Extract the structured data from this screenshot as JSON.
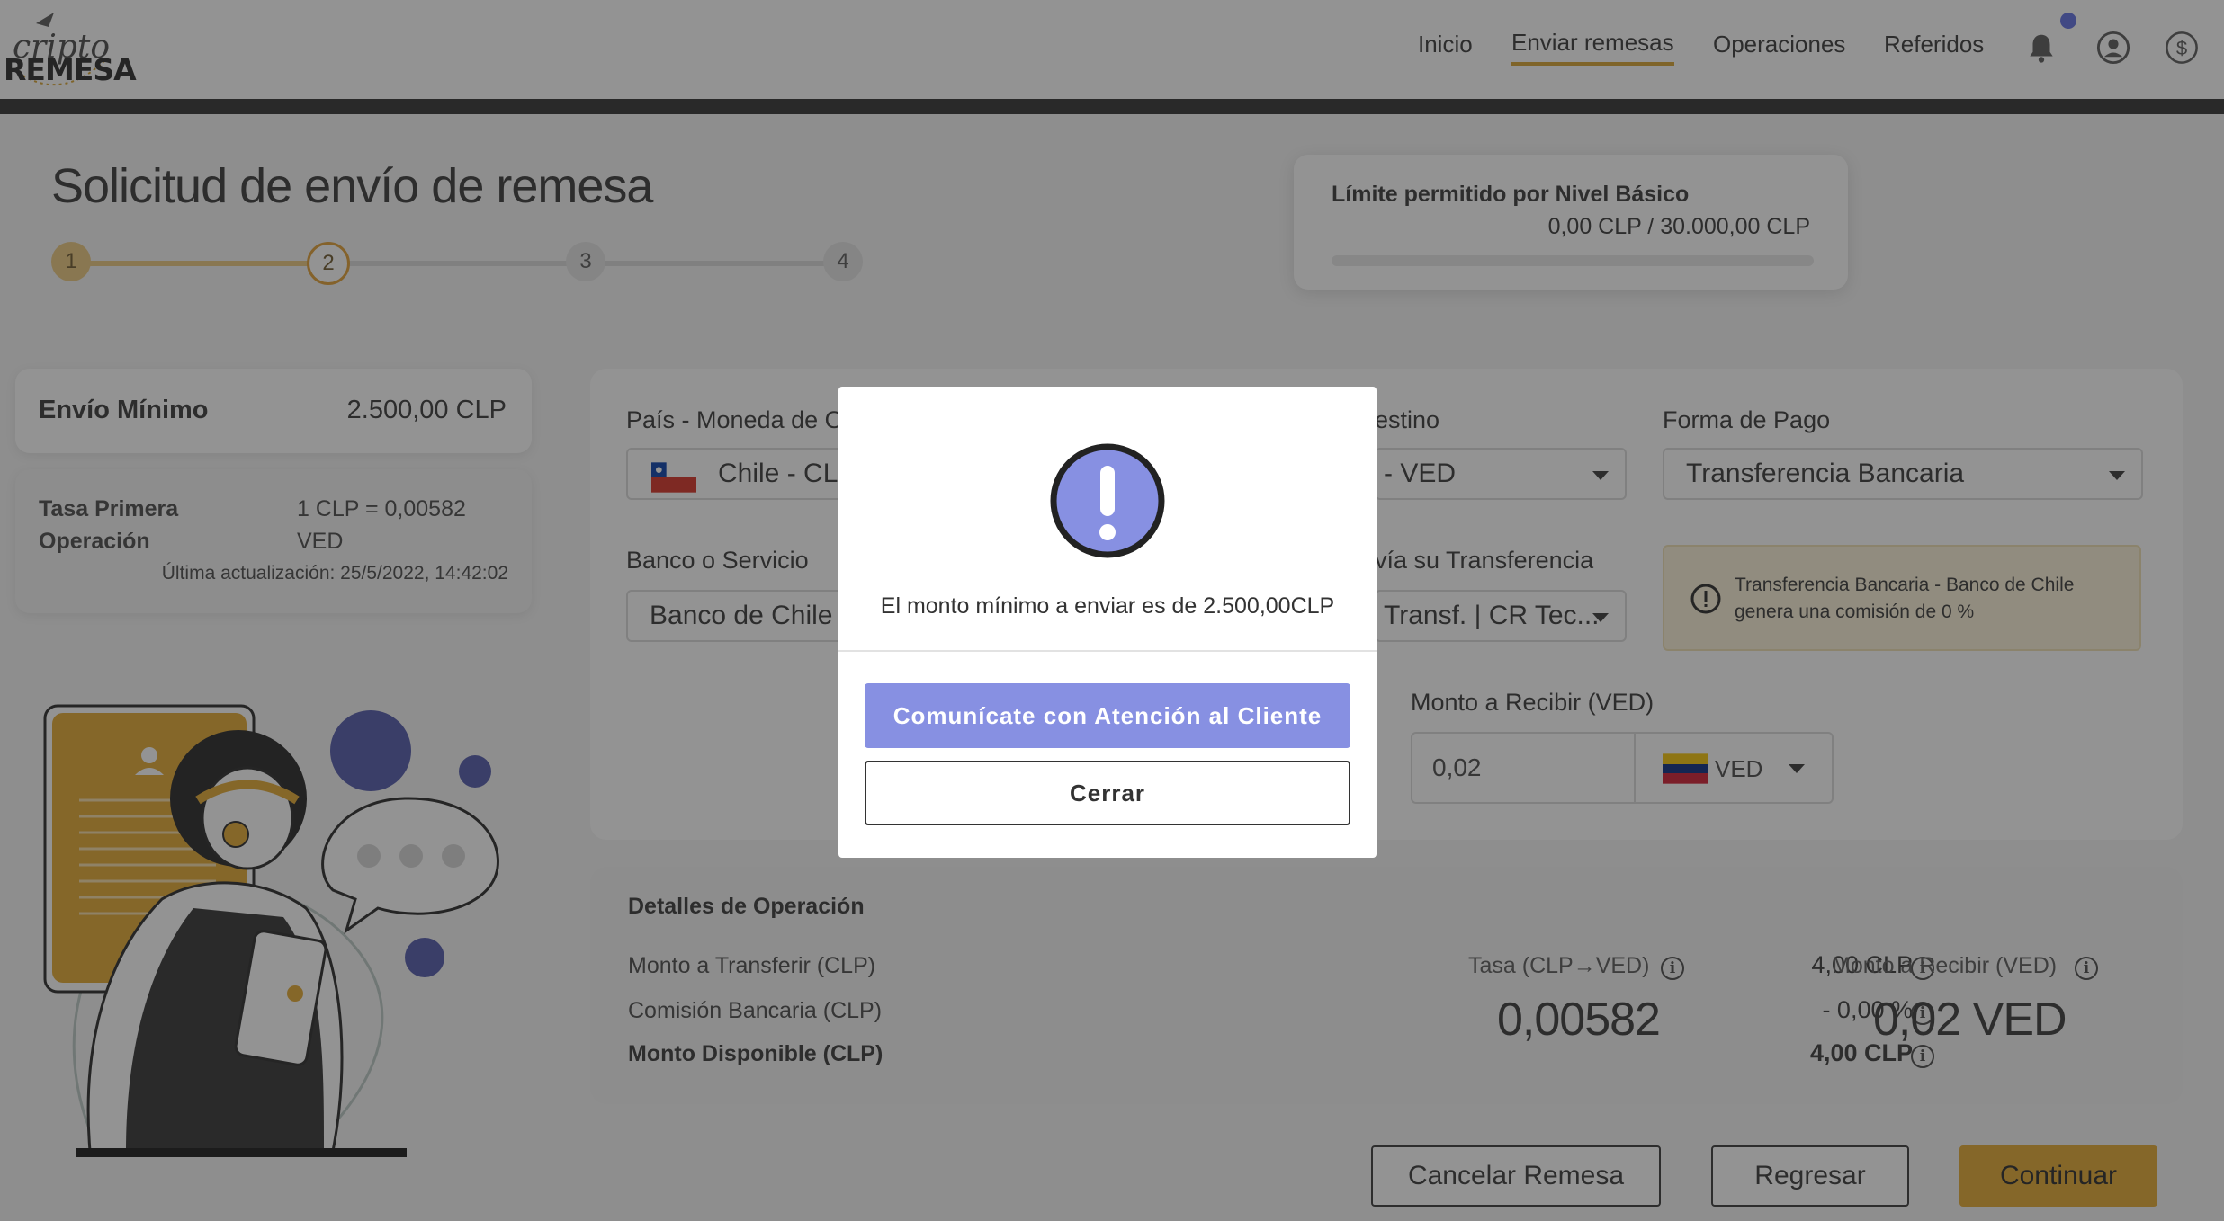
{
  "header": {
    "logo_top": "cripto",
    "logo_bottom": "REMESA",
    "nav": [
      "Inicio",
      "Enviar remesas",
      "Operaciones",
      "Referidos"
    ],
    "active_nav": "Enviar remesas",
    "icons": [
      "bell-icon",
      "user-icon",
      "dollar-icon"
    ]
  },
  "page": {
    "title": "Solicitud de envío de remesa",
    "steps": [
      "1",
      "2",
      "3",
      "4"
    ],
    "current_step": 2
  },
  "limit": {
    "title": "Límite permitido por Nivel Básico",
    "value": "0,00 CLP / 30.000,00 CLP",
    "progress_fraction": 0
  },
  "minimum": {
    "label": "Envío Mínimo",
    "value": "2.500,00 CLP"
  },
  "rate": {
    "label": "Tasa Primera Operación",
    "value": "1 CLP = 0,00582 VED",
    "updated": "Última actualización: 25/5/2022, 14:42:02"
  },
  "form": {
    "origin_label": "País - Moneda de O",
    "origin_value": "Chile - CL",
    "dest_label": "estino",
    "dest_value": "- VED",
    "payment_label": "Forma de Pago",
    "payment_value": "Transferencia Bancaria",
    "bank_label": "Banco o Servicio",
    "bank_value": "Banco de Chile",
    "via_label": "vía su Transferencia",
    "via_value": "Transf. | CR Tec...",
    "notice": "Transferencia Bancaria - Banco de Chile genera una comisión de 0 %",
    "receive_label": "Monto a Recibir (VED)",
    "receive_value": "0,02",
    "receive_currency": "VED"
  },
  "details": {
    "title": "Detalles de Operación",
    "rows": [
      {
        "label": "Monto a Transferir (CLP)",
        "value": "4,00 CLP"
      },
      {
        "label": "Comisión Bancaria (CLP)",
        "value": "- 0,00 %"
      },
      {
        "label": "Monto Disponible (CLP)",
        "value": "4,00 CLP"
      }
    ],
    "rate_head": "Tasa (CLP→VED)",
    "rate_value": "0,00582",
    "receive_head": "Monto a Recibir (VED)",
    "receive_value": "0,02 VED"
  },
  "buttons": {
    "cancel": "Cancelar Remesa",
    "back": "Regresar",
    "continue": "Continuar"
  },
  "modal": {
    "message": "El monto mínimo a enviar es de 2.500,00CLP",
    "primary": "Comunícate con Atención al Cliente",
    "close": "Cerrar"
  },
  "colors": {
    "accent": "#e3a62b",
    "modal_primary": "#8790e2",
    "notification": "#5b6be0"
  }
}
